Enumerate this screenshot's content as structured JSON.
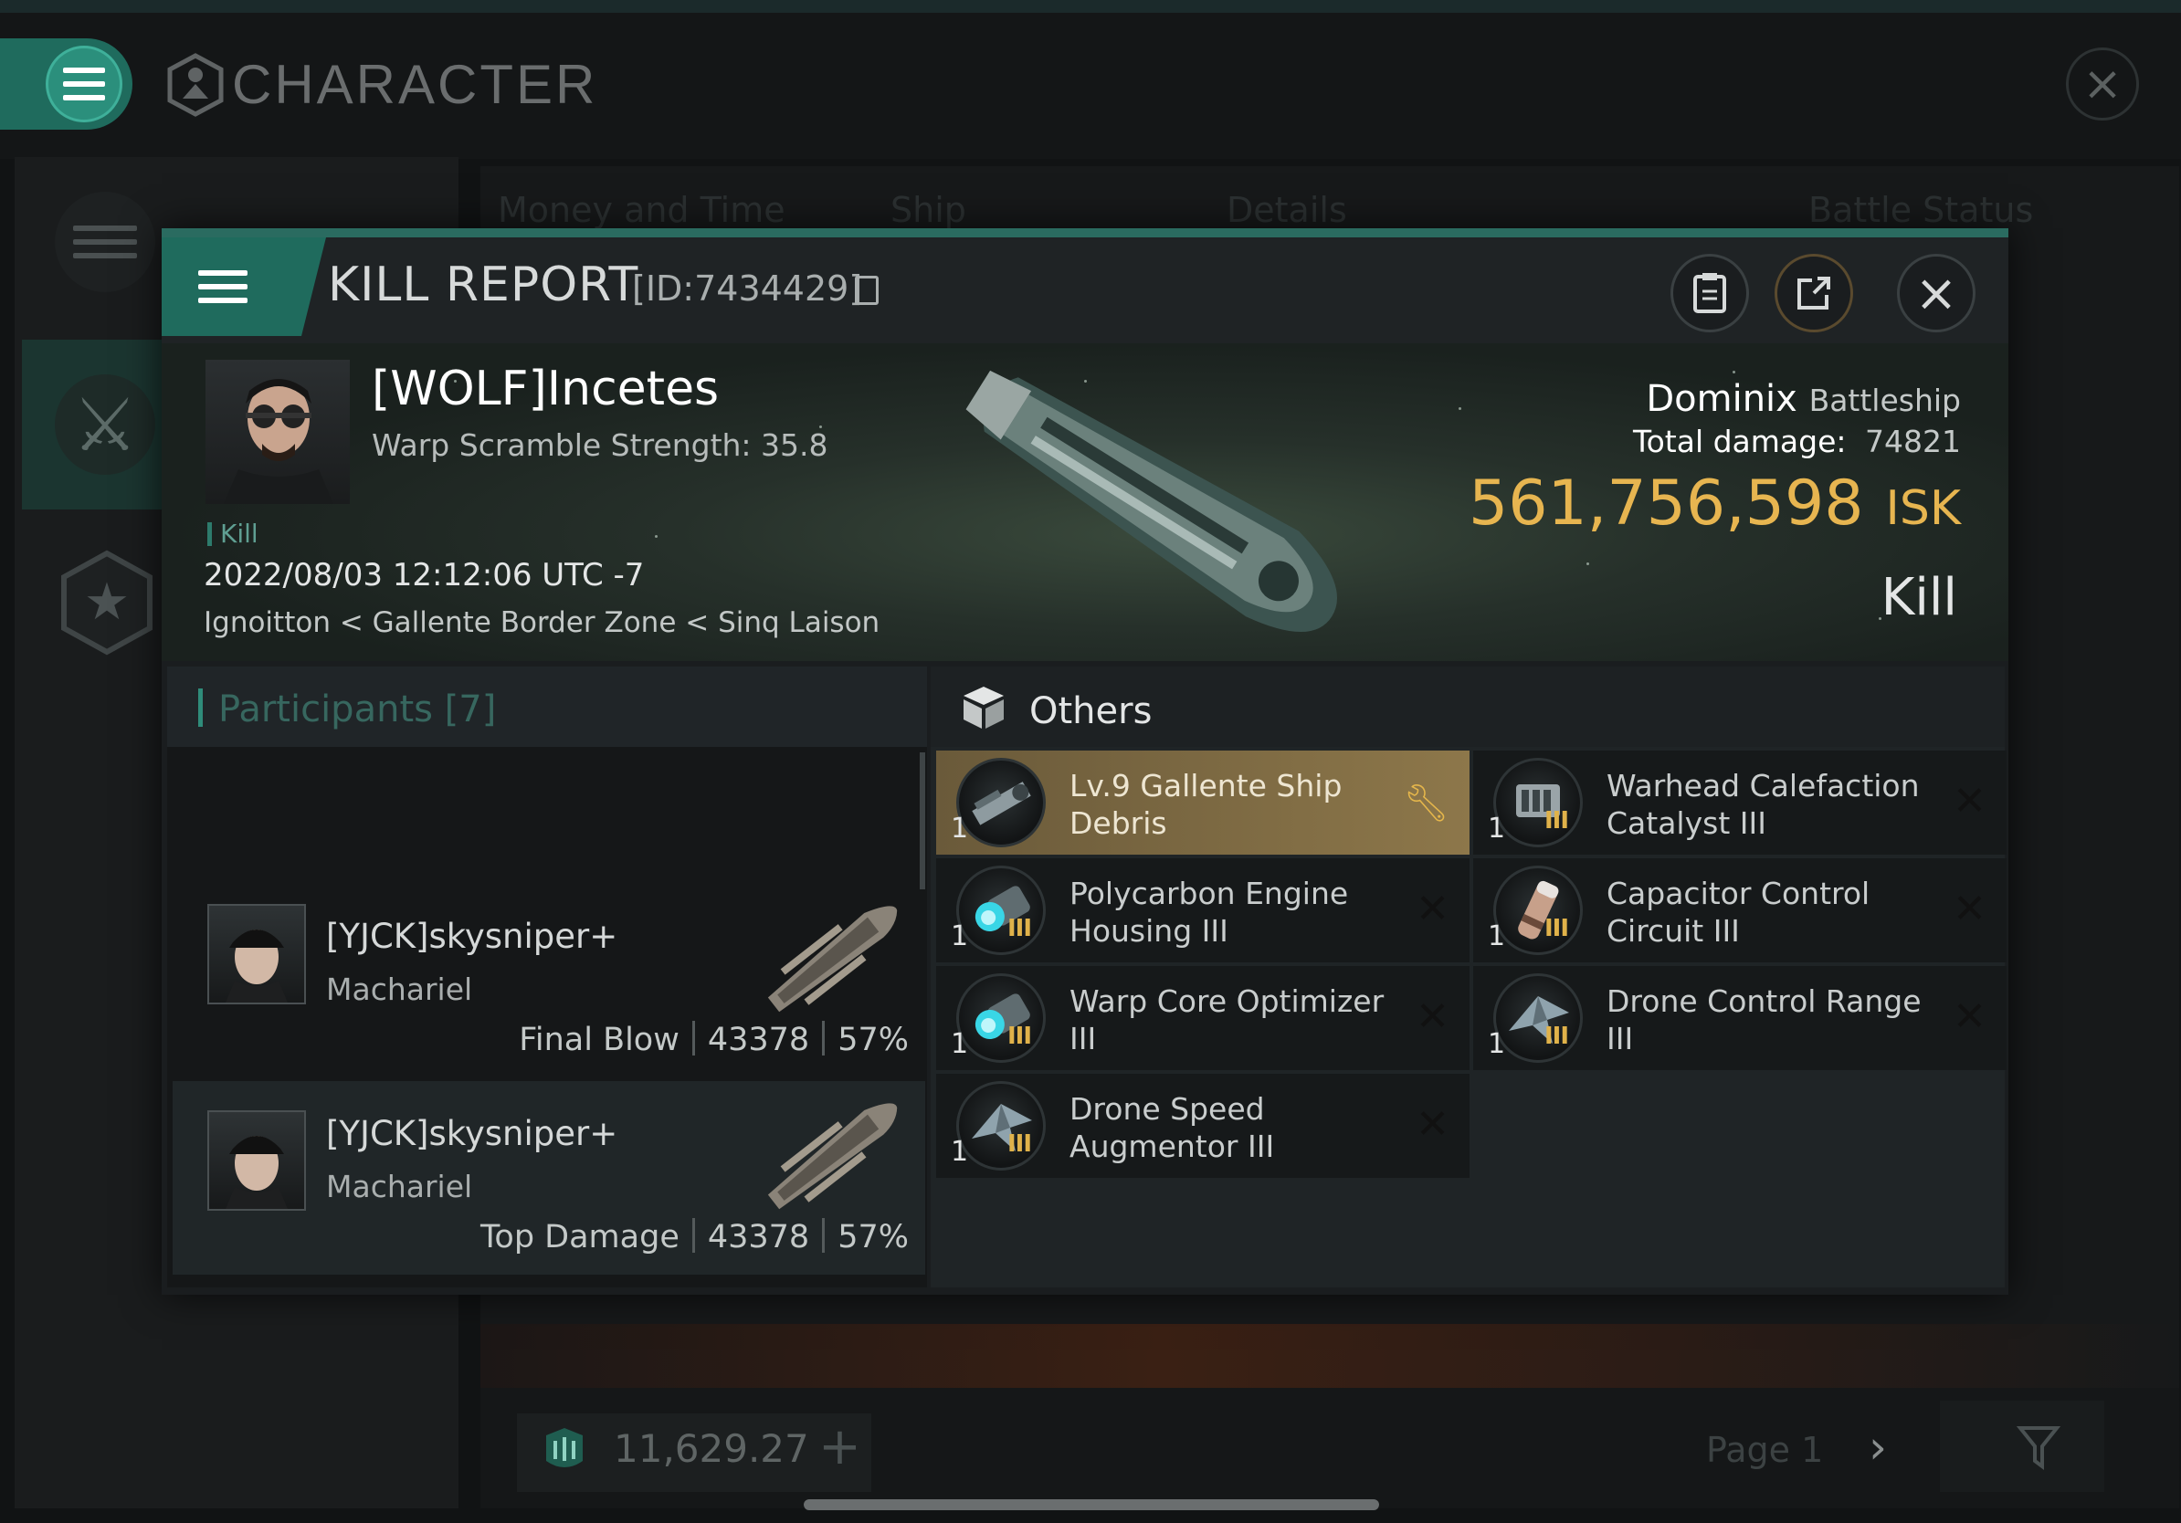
{
  "app": {
    "title": "CHARACTER",
    "columns": [
      "Money and Time",
      "Ship",
      "Details",
      "Battle Status"
    ],
    "wallet_value": "11,629.27",
    "page_label": "Page 1"
  },
  "kill_report": {
    "title": "KILL REPORT",
    "id_label": "[ID:7434429]",
    "victim": {
      "name": "[WOLF]Incetes",
      "subline": "Warp Scramble Strength: 35.8",
      "tag": "Kill",
      "timestamp": "2022/08/03 12:12:06 UTC -7",
      "location": "Ignoitton < Gallente Border Zone < Sinq Laison"
    },
    "ship": {
      "name": "Dominix",
      "class": "Battleship",
      "total_damage_label": "Total damage:",
      "total_damage": "74821",
      "value": "561,756,598",
      "currency": "ISK",
      "result": "Kill"
    },
    "participants": {
      "label": "Participants [7]",
      "rows": [
        {
          "name": "[YJCK]skysniper+",
          "ship": "Machariel",
          "role": "Final Blow",
          "damage": "43378",
          "percent": "57%"
        },
        {
          "name": "[YJCK]skysniper+",
          "ship": "Machariel",
          "role": "Top Damage",
          "damage": "43378",
          "percent": "57%"
        }
      ]
    },
    "others": {
      "label": "Others",
      "items": [
        {
          "name": "Lv.9 Gallente Ship Debris",
          "qty": "1",
          "tier": "",
          "icon": "debris-icon",
          "highlighted": true,
          "action": "wrench-icon"
        },
        {
          "name": "Warhead Calefaction Catalyst III",
          "qty": "1",
          "tier": "III",
          "icon": "launcher-rig-icon",
          "action": "x-icon"
        },
        {
          "name": "Polycarbon Engine Housing III",
          "qty": "1",
          "tier": "III",
          "icon": "engine-rig-icon",
          "action": "x-icon"
        },
        {
          "name": "Capacitor Control Circuit III",
          "qty": "1",
          "tier": "III",
          "icon": "capacitor-rig-icon",
          "action": "x-icon"
        },
        {
          "name": "Warp Core Optimizer III",
          "qty": "1",
          "tier": "III",
          "icon": "warp-rig-icon",
          "action": "x-icon"
        },
        {
          "name": "Drone Control Range III",
          "qty": "1",
          "tier": "III",
          "icon": "drone-rig-icon",
          "action": "x-icon"
        },
        {
          "name": "Drone Speed Augmentor III",
          "qty": "1",
          "tier": "III",
          "icon": "drone-rig-icon",
          "action": "x-icon"
        }
      ]
    }
  }
}
